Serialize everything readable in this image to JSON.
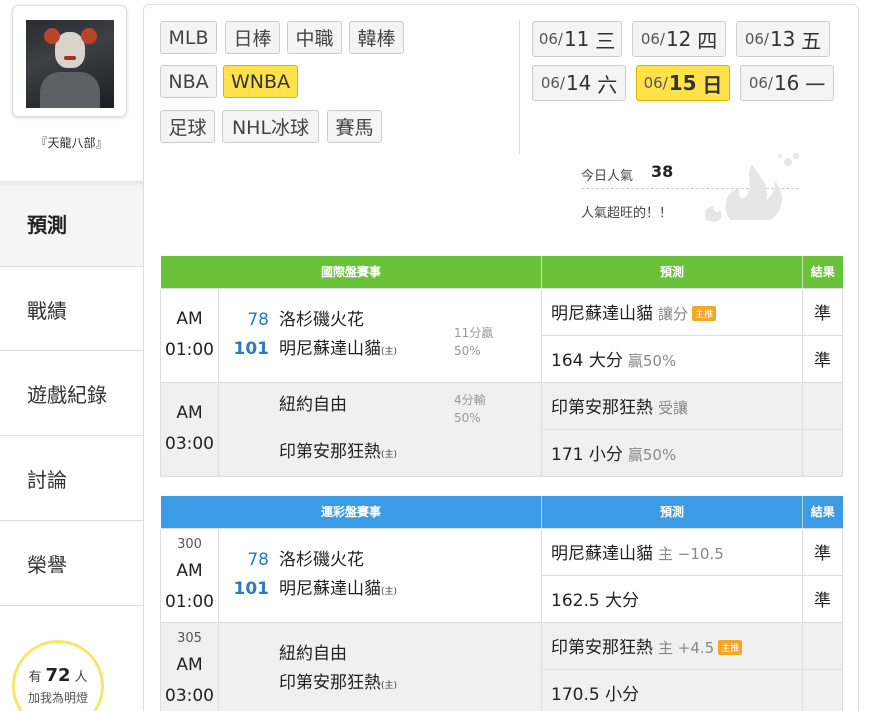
{
  "profile": {
    "username": "『天龍八部』"
  },
  "nav": {
    "items": [
      {
        "label": "預測"
      },
      {
        "label": "戰績"
      },
      {
        "label": "遊戲紀錄"
      },
      {
        "label": "討論"
      },
      {
        "label": "榮譽"
      }
    ]
  },
  "fans": {
    "prefix": "有",
    "count": "72",
    "suffix": "人",
    "caption": "加我為明燈"
  },
  "sports": [
    {
      "label": "MLB"
    },
    {
      "label": "日棒"
    },
    {
      "label": "中職"
    },
    {
      "label": "韓棒"
    },
    {
      "label": "NBA"
    },
    {
      "label": "WNBA",
      "active": true
    },
    {
      "label": "足球"
    },
    {
      "label": "NHL冰球"
    },
    {
      "label": "賽馬"
    }
  ],
  "dates": [
    {
      "md": "06/",
      "day": "11",
      "wd": "三"
    },
    {
      "md": "06/",
      "day": "12",
      "wd": "四"
    },
    {
      "md": "06/",
      "day": "13",
      "wd": "五"
    },
    {
      "md": "06/",
      "day": "14",
      "wd": "六"
    },
    {
      "md": "06/",
      "day": "15",
      "wd": "日",
      "active": true
    },
    {
      "md": "06/",
      "day": "16",
      "wd": "一"
    }
  ],
  "popularity": {
    "label": "今日人氣",
    "count": "38",
    "status": "人氣超旺的！！"
  },
  "intl": {
    "headers": {
      "event": "國際盤賽事",
      "prediction": "預測",
      "result": "結果"
    },
    "g1": {
      "time": "AM 01:00",
      "away_score": "78",
      "away": "洛杉磯火花",
      "home_score": "101",
      "home": "明尼蘇達山貓",
      "home_tag": "(主)",
      "res1": "11分贏",
      "res2": "50%",
      "p1": "明尼蘇達山貓",
      "p1_sub": "讓分",
      "p1_tag": "主推",
      "r1": "準",
      "p2": "164 大分",
      "p2_sub": "贏50%",
      "r2": "準"
    },
    "g2": {
      "time": "AM 03:00",
      "away": "紐約自由",
      "home": "印第安那狂熱",
      "home_tag": "(主)",
      "res1": "4分輸",
      "res2": "50%",
      "p1": "印第安那狂熱",
      "p1_sub": "受讓",
      "p2": "171 小分",
      "p2_sub": "贏50%"
    }
  },
  "sport": {
    "headers": {
      "event": "運彩盤賽事",
      "prediction": "預測",
      "result": "結果"
    },
    "g1": {
      "no": "300",
      "time": "AM 01:00",
      "away_score": "78",
      "away": "洛杉磯火花",
      "home_score": "101",
      "home": "明尼蘇達山貓",
      "home_tag": "(主)",
      "p1": "明尼蘇達山貓",
      "p1_sub": "主 −10.5",
      "r1": "準",
      "p2": "162.5 大分",
      "r2": "準"
    },
    "g2": {
      "no": "305",
      "time": "AM 03:00",
      "away": "紐約自由",
      "home": "印第安那狂熱",
      "home_tag": "(主)",
      "p1": "印第安那狂熱",
      "p1_sub": "主 +4.5",
      "p1_tag": "主推",
      "p2": "170.5 小分"
    }
  },
  "colors": {
    "green_header": "#69c23a",
    "blue_header": "#3b9be4",
    "active_chip": "#ffe24a",
    "score_blue": "#2a7cbf",
    "accurate_green": "#3aa43a"
  }
}
